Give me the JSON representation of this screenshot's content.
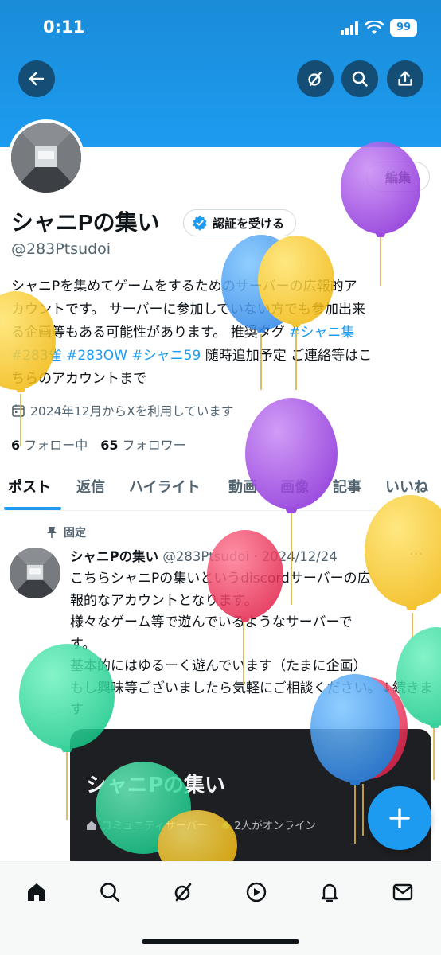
{
  "status_bar": {
    "time": "0:11",
    "battery": "99"
  },
  "profile": {
    "display_name": "シャニPの集い",
    "handle": "@283Ptsudoi",
    "edit_label": "編集",
    "verify_label": "認証を受ける",
    "bio_lines": [
      "シャニPを集めてゲームをするためのサーバーの広報的ア",
      "カウントです。 サーバーに参加していない方でも参加出来",
      "る企画等もある可能性があります。 推奨タグ "
    ],
    "bio_tags": [
      "#シャニ集",
      "#283雀",
      "#283OW",
      "#シャニ59"
    ],
    "bio_after_tags": " 随時追加予定 ご連絡等はこ",
    "bio_last": "ちらのアカウントまで",
    "joined": "2024年12月からXを利用しています",
    "following_count": "6",
    "following_label": "フォロー中",
    "followers_count": "65",
    "followers_label": "フォロワー"
  },
  "tabs": [
    "ポスト",
    "返信",
    "ハイライト",
    "動画",
    "画像",
    "記事",
    "いいね"
  ],
  "post": {
    "pinned_label": "固定",
    "author": "シャニPの集い",
    "meta": "@283Ptsudoi · 2024/12/24",
    "more": "···",
    "text": "こちらシャニPの集いというdiscordサーバーの広\n報的なアカウントとなります。\n様々なゲーム等で遊んでいるようなサーバーで\nす。\n基本的にはゆるーく遊んでいます（たまに企画）\nもし興味等ございましたら気軽にご相談ください。↓続きます",
    "card_title": "シャニPの集い",
    "card_community": "コミュニティサーバー",
    "card_online": "2人がオンライン"
  },
  "colors": {
    "accent": "#1d9bf0",
    "banner": "#1a8cd8",
    "text": "#0f1419",
    "muted": "#536471"
  },
  "icons": {
    "header": [
      "back-arrow-icon",
      "grok-icon",
      "search-icon",
      "share-icon"
    ],
    "nav": [
      "home-icon",
      "search-icon",
      "grok-icon",
      "video-play-icon",
      "bell-icon",
      "mail-icon"
    ]
  }
}
